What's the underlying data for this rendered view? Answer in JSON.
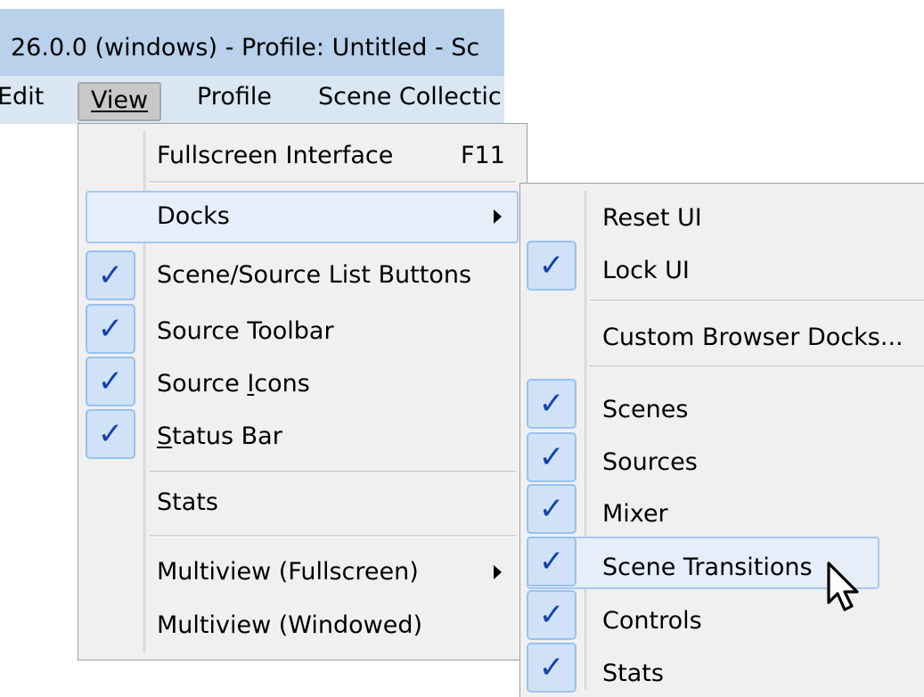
{
  "window": {
    "title": "26.0.0 (windows) - Profile: Untitled - Sc"
  },
  "menubar": {
    "edit": "Edit",
    "view": "View",
    "profile": "Profile",
    "scene_collection": "Scene Collectic"
  },
  "view_menu": {
    "fullscreen": {
      "label": "Fullscreen Interface",
      "shortcut": "F11"
    },
    "docks": "Docks",
    "scene_source_buttons": "Scene/Source List Buttons",
    "source_toolbar": "Source Toolbar",
    "source_icons": {
      "pre": "Source ",
      "ul": "I",
      "post": "cons"
    },
    "status_bar": {
      "ul": "S",
      "post": "tatus Bar"
    },
    "stats": "Stats",
    "multiview_fullscreen": "Multiview (Fullscreen)",
    "multiview_windowed": "Multiview (Windowed)"
  },
  "docks_menu": {
    "reset_ui": "Reset UI",
    "lock_ui": "Lock UI",
    "custom_browser_docks": "Custom Browser Docks...",
    "scenes": "Scenes",
    "sources": "Sources",
    "mixer": "Mixer",
    "scene_transitions": "Scene Transitions",
    "controls": "Controls",
    "stats": "Stats"
  },
  "check_mark": "✓"
}
